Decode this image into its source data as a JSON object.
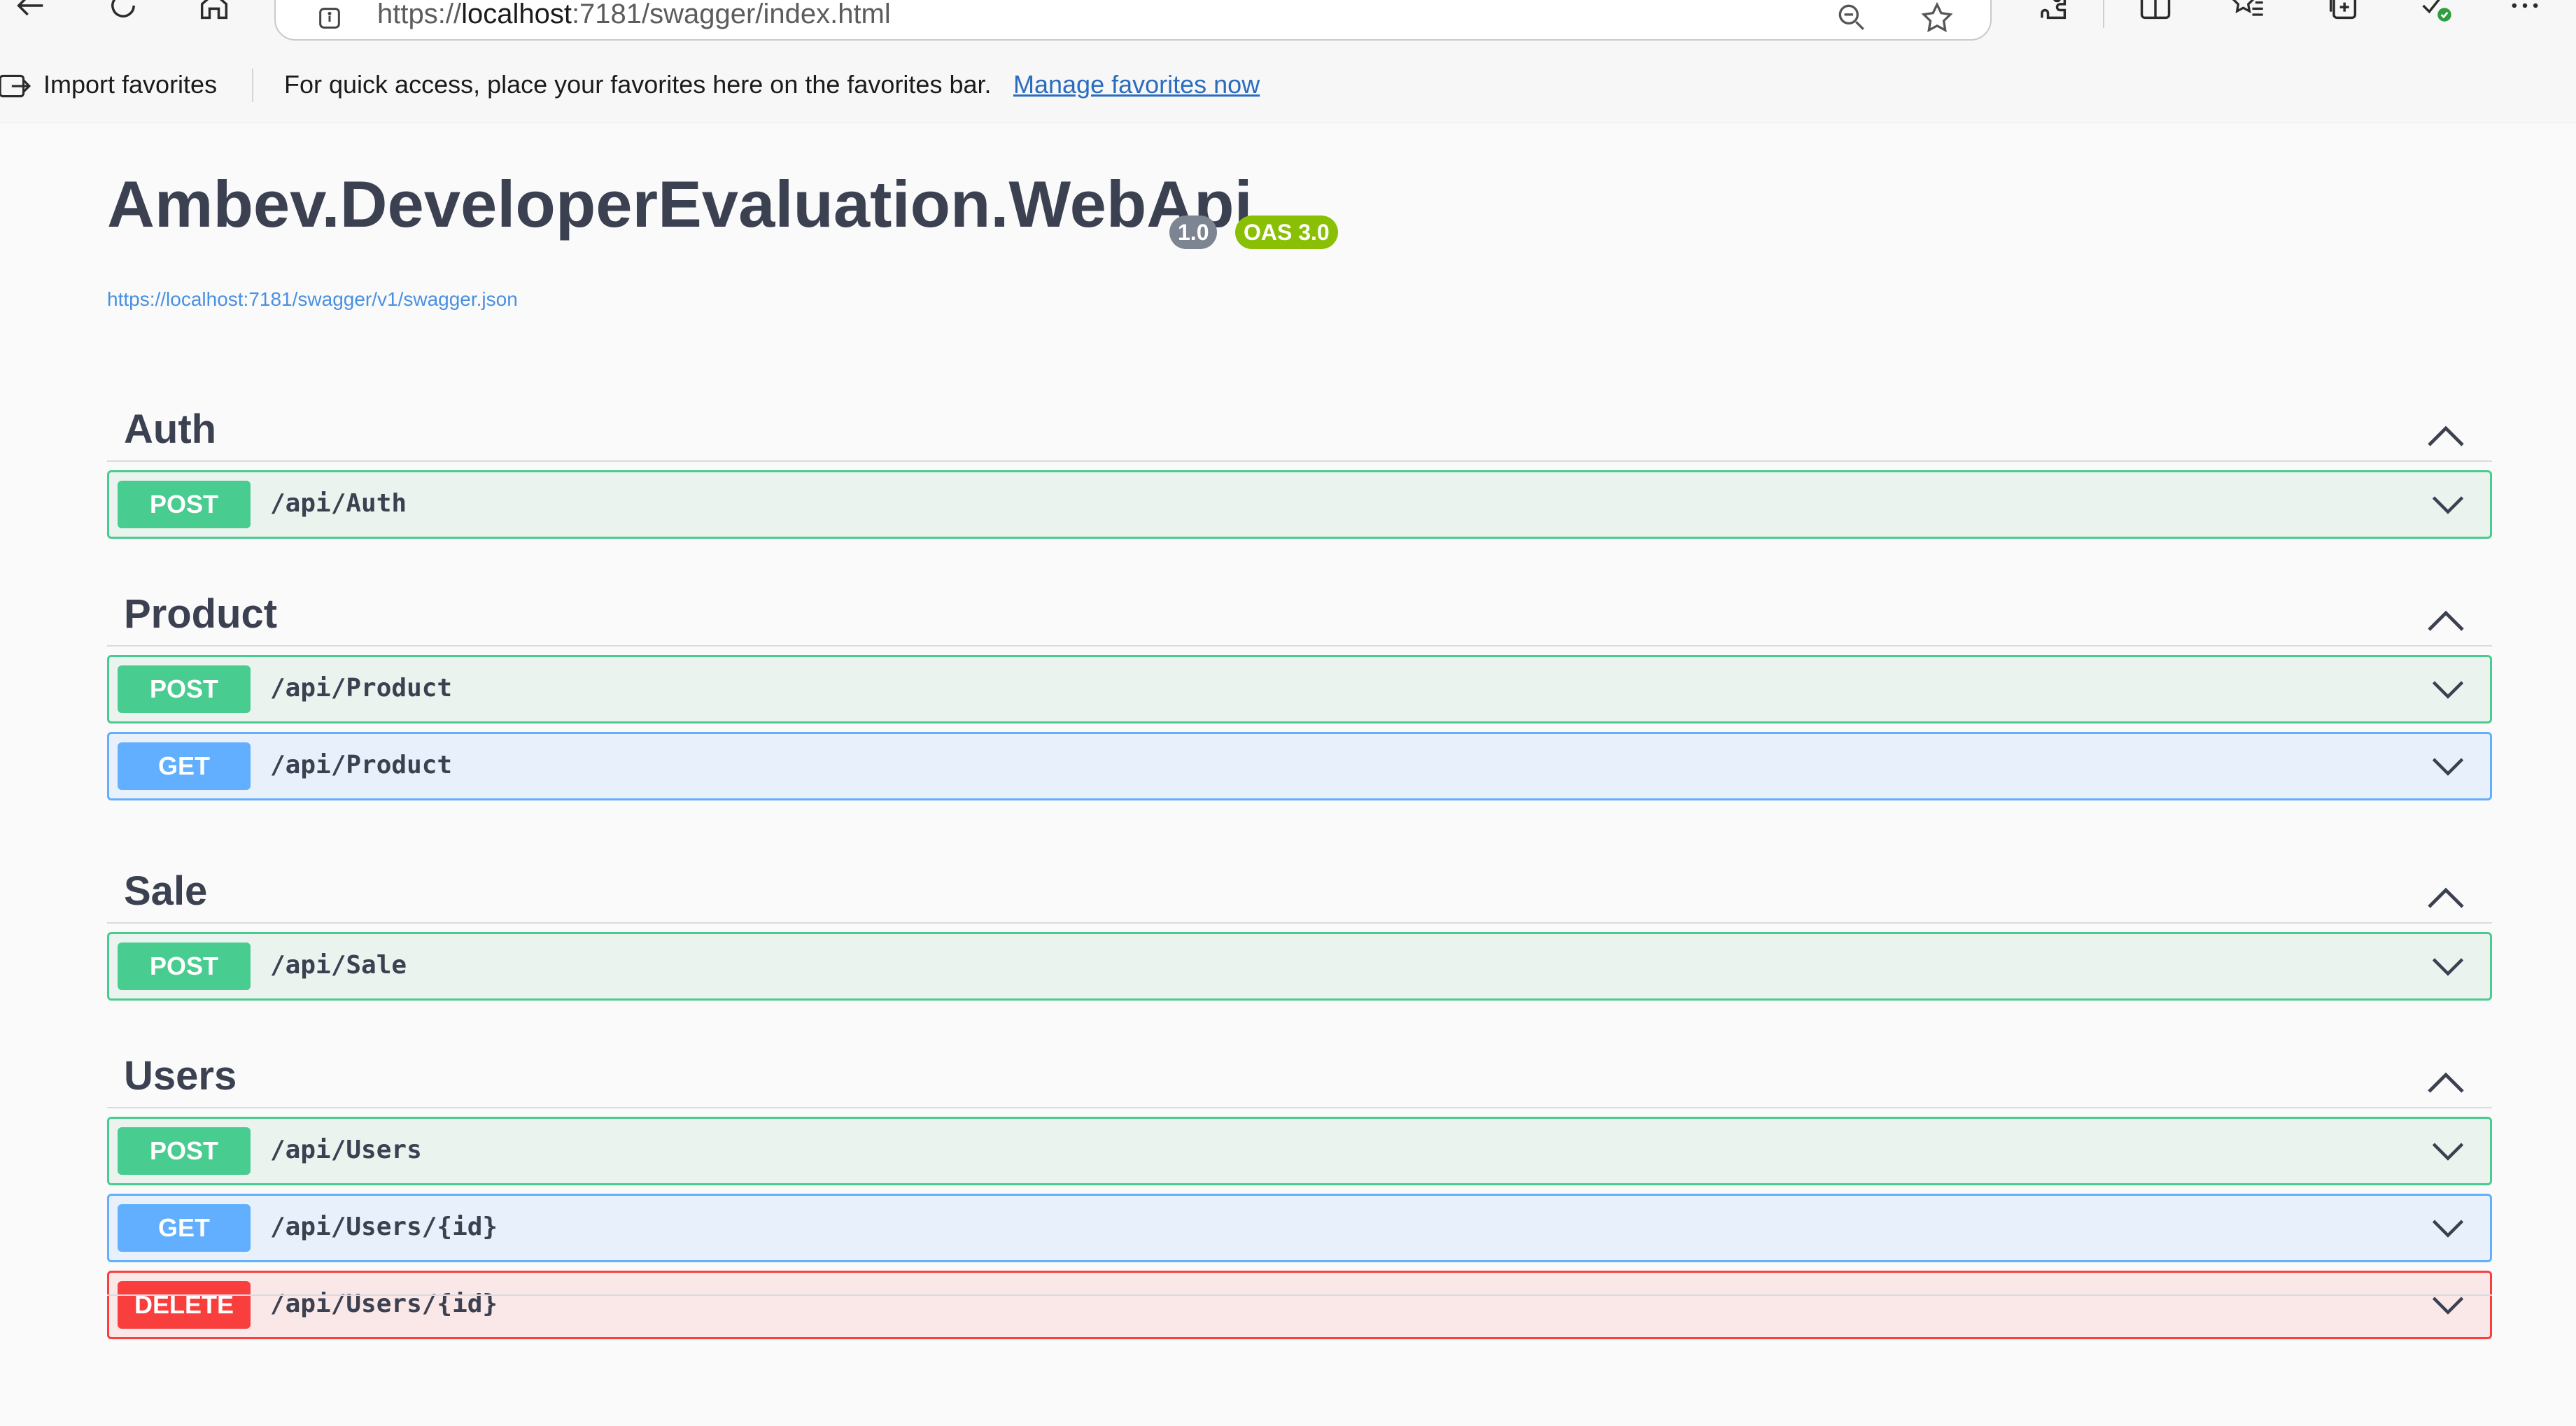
{
  "browser": {
    "url_prefix": "https://",
    "url_host": "localhost",
    "url_rest": ":7181/swagger/index.html"
  },
  "favorites_bar": {
    "import_label": "Import favorites",
    "message": "For quick access, place your favorites here on the favorites bar.",
    "manage_link": "Manage favorites now"
  },
  "info": {
    "title": "Ambev.DeveloperEvaluation.WebApi",
    "version": "1.0",
    "oas": "OAS 3.0",
    "spec_url": "https://localhost:7181/swagger/v1/swagger.json"
  },
  "sections": [
    {
      "name": "Auth",
      "operations": [
        {
          "method": "POST",
          "path": "/api/Auth"
        }
      ]
    },
    {
      "name": "Product",
      "operations": [
        {
          "method": "POST",
          "path": "/api/Product"
        },
        {
          "method": "GET",
          "path": "/api/Product"
        }
      ]
    },
    {
      "name": "Sale",
      "operations": [
        {
          "method": "POST",
          "path": "/api/Sale"
        }
      ]
    },
    {
      "name": "Users",
      "operations": [
        {
          "method": "POST",
          "path": "/api/Users"
        },
        {
          "method": "GET",
          "path": "/api/Users/{id}"
        },
        {
          "method": "DELETE",
          "path": "/api/Users/{id}"
        }
      ]
    }
  ],
  "colors": {
    "post": "#49cc90",
    "get": "#61affe",
    "delete": "#f93e3e",
    "version_badge": "#7d8492",
    "oas_badge": "#89bf04"
  }
}
